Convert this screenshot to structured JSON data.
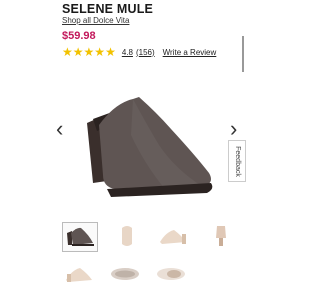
{
  "product": {
    "title": "SELENE MULE",
    "brand_link": "Shop all Dolce Vita",
    "price": "$59.98",
    "price_color": "#c2185b",
    "rating_value": "4.8",
    "rating_count": "(156)",
    "write_review": "Write a Review",
    "star_color": "#f2c200",
    "stars": 5
  },
  "gallery": {
    "prev_icon": "chevron-left-icon",
    "next_icon": "chevron-right-icon",
    "feedback_label": "Feedback",
    "thumbnails": [
      "side-view",
      "front-view",
      "inner-side-view",
      "back-view",
      "heel-view",
      "sole-view",
      "top-view"
    ]
  }
}
